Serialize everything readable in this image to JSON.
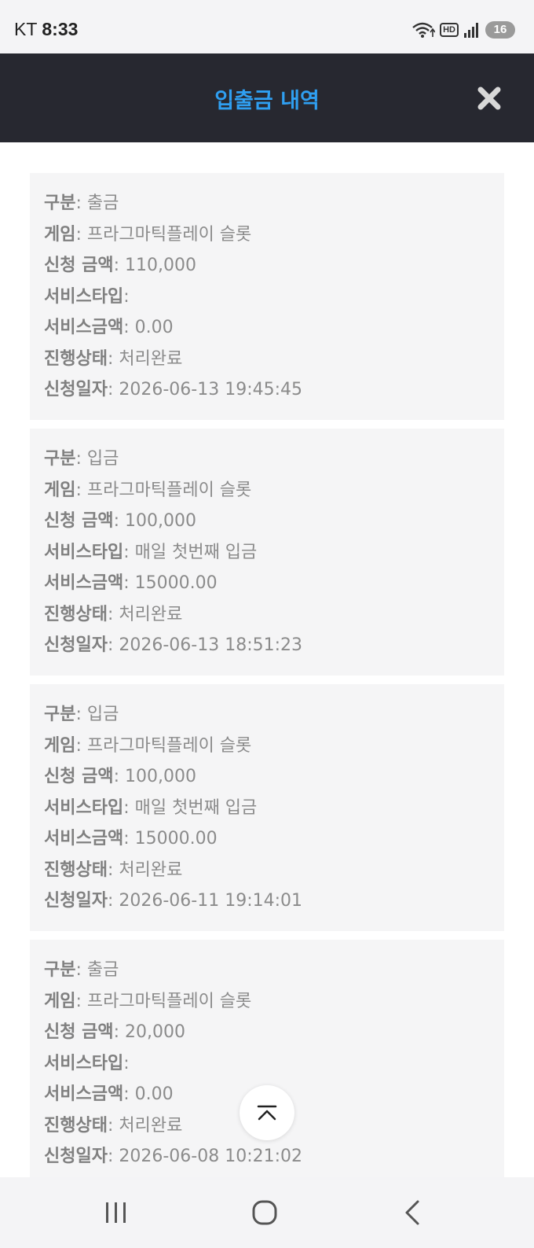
{
  "status_bar": {
    "carrier": "KT",
    "time": "8:33",
    "hd_label": "HD",
    "battery": "16",
    "icons": [
      "wifi-icon",
      "hd-icon",
      "signal-icon",
      "battery-icon"
    ]
  },
  "header": {
    "title": "입출금 내역",
    "title_color": "#2f9ff1",
    "close_icon": "close-icon"
  },
  "labels": {
    "type": "구분",
    "game": "게임",
    "amount": "신청 금액",
    "service_type": "서비스타입",
    "service_amount": "서비스금액",
    "status": "진행상태",
    "date": "신청일자"
  },
  "transactions": [
    {
      "type": "출금",
      "game": "프라그마틱플레이 슬롯",
      "amount": "110,000",
      "service_type": "",
      "service_amount": "0.00",
      "status": "처리완료",
      "date": "2026-06-13 19:45:45"
    },
    {
      "type": "입금",
      "game": "프라그마틱플레이 슬롯",
      "amount": "100,000",
      "service_type": "매일 첫번째 입금",
      "service_amount": "15000.00",
      "status": "처리완료",
      "date": "2026-06-13 18:51:23"
    },
    {
      "type": "입금",
      "game": "프라그마틱플레이 슬롯",
      "amount": "100,000",
      "service_type": "매일 첫번째 입금",
      "service_amount": "15000.00",
      "status": "처리완료",
      "date": "2026-06-11 19:14:01"
    },
    {
      "type": "출금",
      "game": "프라그마틱플레이 슬롯",
      "amount": "20,000",
      "service_type": "",
      "service_amount": "0.00",
      "status": "처리완료",
      "date": "2026-06-08 10:21:02"
    }
  ],
  "scroll_top_button": {
    "icon": "chevron-up-icon"
  },
  "nav_bar": {
    "icons": [
      "recent-apps-icon",
      "home-icon",
      "back-icon"
    ]
  }
}
